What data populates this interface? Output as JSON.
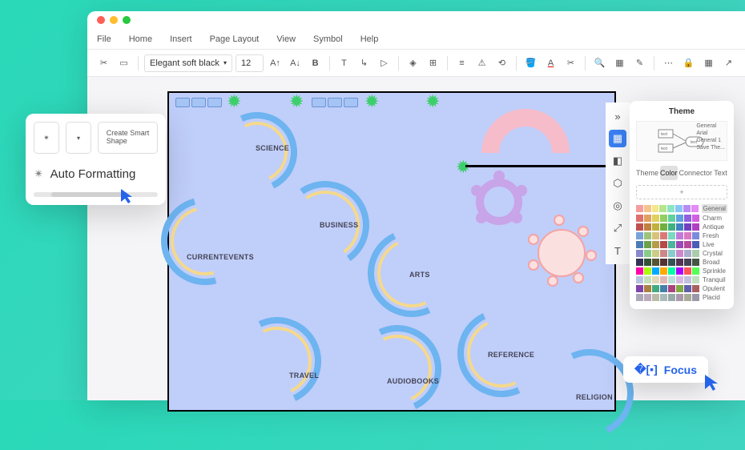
{
  "menu": {
    "file": "File",
    "home": "Home",
    "insert": "Insert",
    "pageLayout": "Page Layout",
    "view": "View",
    "symbol": "Symbol",
    "help": "Help"
  },
  "toolbar": {
    "font": "Elegant soft black",
    "size": "12"
  },
  "popup": {
    "createSmart": "Create Smart\nShape",
    "autoFormatting": "Auto Formatting"
  },
  "canvas": {
    "labels": {
      "science": "SCIENCE",
      "currentEvents": "CURRENTEVENTS",
      "business": "BUSINESS",
      "arts": "ARTS",
      "travel": "TRAVEL",
      "audiobooks": "AUDIOBOOKS",
      "reference": "REFERENCE",
      "religion": "RELIGION"
    }
  },
  "themePanel": {
    "title": "Theme",
    "sideItems": [
      "General",
      "Arial",
      "General 1",
      "Save The..."
    ],
    "tabs": {
      "theme": "Theme",
      "color": "Color",
      "connector": "Connector",
      "text": "Text"
    },
    "add": "+",
    "schemes": [
      "General",
      "Charm",
      "Antique",
      "Fresh",
      "Live",
      "Crystal",
      "Broad",
      "Sprinkle",
      "Tranquil",
      "Opulent",
      "Placid"
    ]
  },
  "focus": {
    "label": "Focus"
  },
  "swatchPalettes": [
    [
      "#f59e9e",
      "#f5c48b",
      "#f5e58b",
      "#b8e58b",
      "#8be5c4",
      "#8bc4f5",
      "#b88bf5",
      "#e58bf5"
    ],
    [
      "#e07070",
      "#e0a060",
      "#e0d060",
      "#90d060",
      "#60d0a0",
      "#60a0e0",
      "#9060e0",
      "#d060e0"
    ],
    [
      "#c05050",
      "#c08040",
      "#c0b040",
      "#70b040",
      "#40b080",
      "#4080c0",
      "#7040c0",
      "#b040c0"
    ],
    [
      "#7aa3d9",
      "#9cc47a",
      "#d9c27a",
      "#d97a7a",
      "#7ad9c2",
      "#c27ad9",
      "#d97ac2",
      "#7a8cd9"
    ],
    [
      "#4a7bb5",
      "#6ca04a",
      "#b59c4a",
      "#b54a4a",
      "#4ab59c",
      "#9c4ab5",
      "#b54a9c",
      "#4a5cb5"
    ],
    [
      "#88c",
      "#8c8",
      "#cc8",
      "#c88",
      "#8cc",
      "#c8c",
      "#aac",
      "#aca"
    ],
    [
      "#335",
      "#353",
      "#553",
      "#533",
      "#355",
      "#535",
      "#445",
      "#454"
    ],
    [
      "#f0a",
      "#af0",
      "#0af",
      "#fa0",
      "#0fa",
      "#a0f",
      "#f55",
      "#5f5"
    ],
    [
      "#b8c4e0",
      "#c4e0b8",
      "#e0d8b8",
      "#e0b8b8",
      "#b8e0d8",
      "#d8b8e0",
      "#c0c0e0",
      "#c0e0c0"
    ],
    [
      "#8044aa",
      "#aa8044",
      "#44aa80",
      "#4480aa",
      "#aa4480",
      "#80aa44",
      "#6060aa",
      "#aa6060"
    ],
    [
      "#aab",
      "#bab",
      "#bba",
      "#abb",
      "#9aa",
      "#a9a",
      "#aa9",
      "#99a"
    ]
  ]
}
